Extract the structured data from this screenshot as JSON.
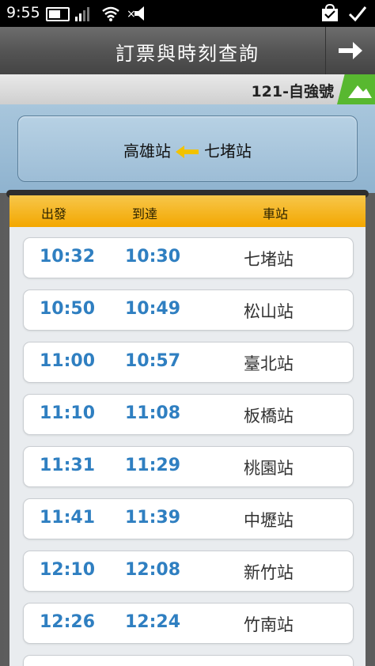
{
  "status_bar": {
    "time": "9:55",
    "icons": [
      "battery-icon",
      "signal-icon",
      "wifi-icon",
      "mute-icon",
      "bag-icon",
      "check-icon"
    ]
  },
  "title_bar": {
    "title": "訂票與時刻查詢",
    "nav_icon": "arrow-right-icon"
  },
  "route": {
    "label": "121-自強號",
    "badge_icon": "mountain-icon",
    "badge_color": "#58b830"
  },
  "trip": {
    "from": "七堵站",
    "to": "高雄站",
    "arrow_icon": "arrow-left-icon",
    "arrow_color": "#f2c200"
  },
  "table": {
    "headers": {
      "depart": "出發",
      "arrive": "到達",
      "station": "車站"
    },
    "header_color": "#f3a700",
    "rows": [
      {
        "station": "七堵站",
        "arrive": "10:30",
        "depart": "10:32"
      },
      {
        "station": "松山站",
        "arrive": "10:49",
        "depart": "10:50"
      },
      {
        "station": "臺北站",
        "arrive": "10:57",
        "depart": "11:00"
      },
      {
        "station": "板橋站",
        "arrive": "11:08",
        "depart": "11:10"
      },
      {
        "station": "桃園站",
        "arrive": "11:29",
        "depart": "11:31"
      },
      {
        "station": "中壢站",
        "arrive": "11:39",
        "depart": "11:41"
      },
      {
        "station": "新竹站",
        "arrive": "12:08",
        "depart": "12:10"
      },
      {
        "station": "竹南站",
        "arrive": "12:24",
        "depart": "12:26"
      }
    ],
    "time_color": "#2f7fc1"
  }
}
